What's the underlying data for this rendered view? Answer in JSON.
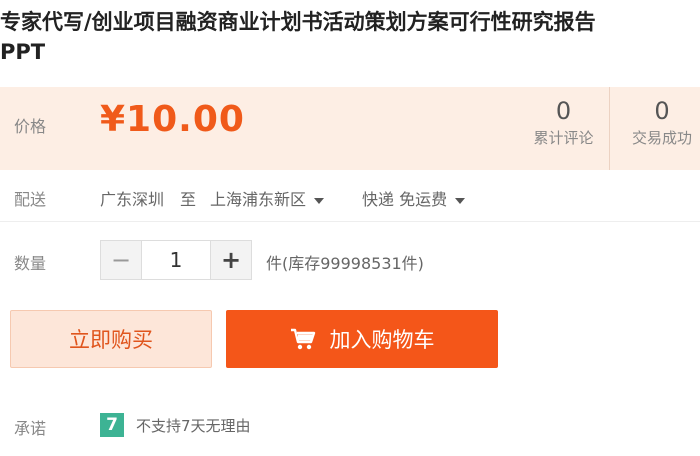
{
  "product": {
    "title_line1": "专家代写/创业项目融资商业计划书活动策划方案可行性研究报告",
    "title_line2": "PPT"
  },
  "price": {
    "label": "价格",
    "value": "¥10.00"
  },
  "stats": {
    "reviews_count": "0",
    "reviews_label": "累计评论",
    "deals_count": "0",
    "deals_label": "交易成功"
  },
  "shipping": {
    "label": "配送",
    "from": "广东深圳",
    "to_word": "至",
    "destination": "上海浦东新区",
    "method": "快递 免运费"
  },
  "quantity": {
    "label": "数量",
    "minus": "−",
    "value": "1",
    "plus": "+",
    "stock_text": "件(库存99998531件)"
  },
  "actions": {
    "buy_now": "立即购买",
    "add_to_cart": "加入购物车"
  },
  "promise": {
    "label": "承诺",
    "badge": "7",
    "text": "不支持7天无理由"
  },
  "colors": {
    "accent": "#f45619",
    "price": "#f05a1a",
    "price_band": "#fdeee4",
    "badge": "#3db394"
  },
  "icons": [
    "cart-icon",
    "caret-down-icon",
    "seven-day-badge-icon"
  ]
}
